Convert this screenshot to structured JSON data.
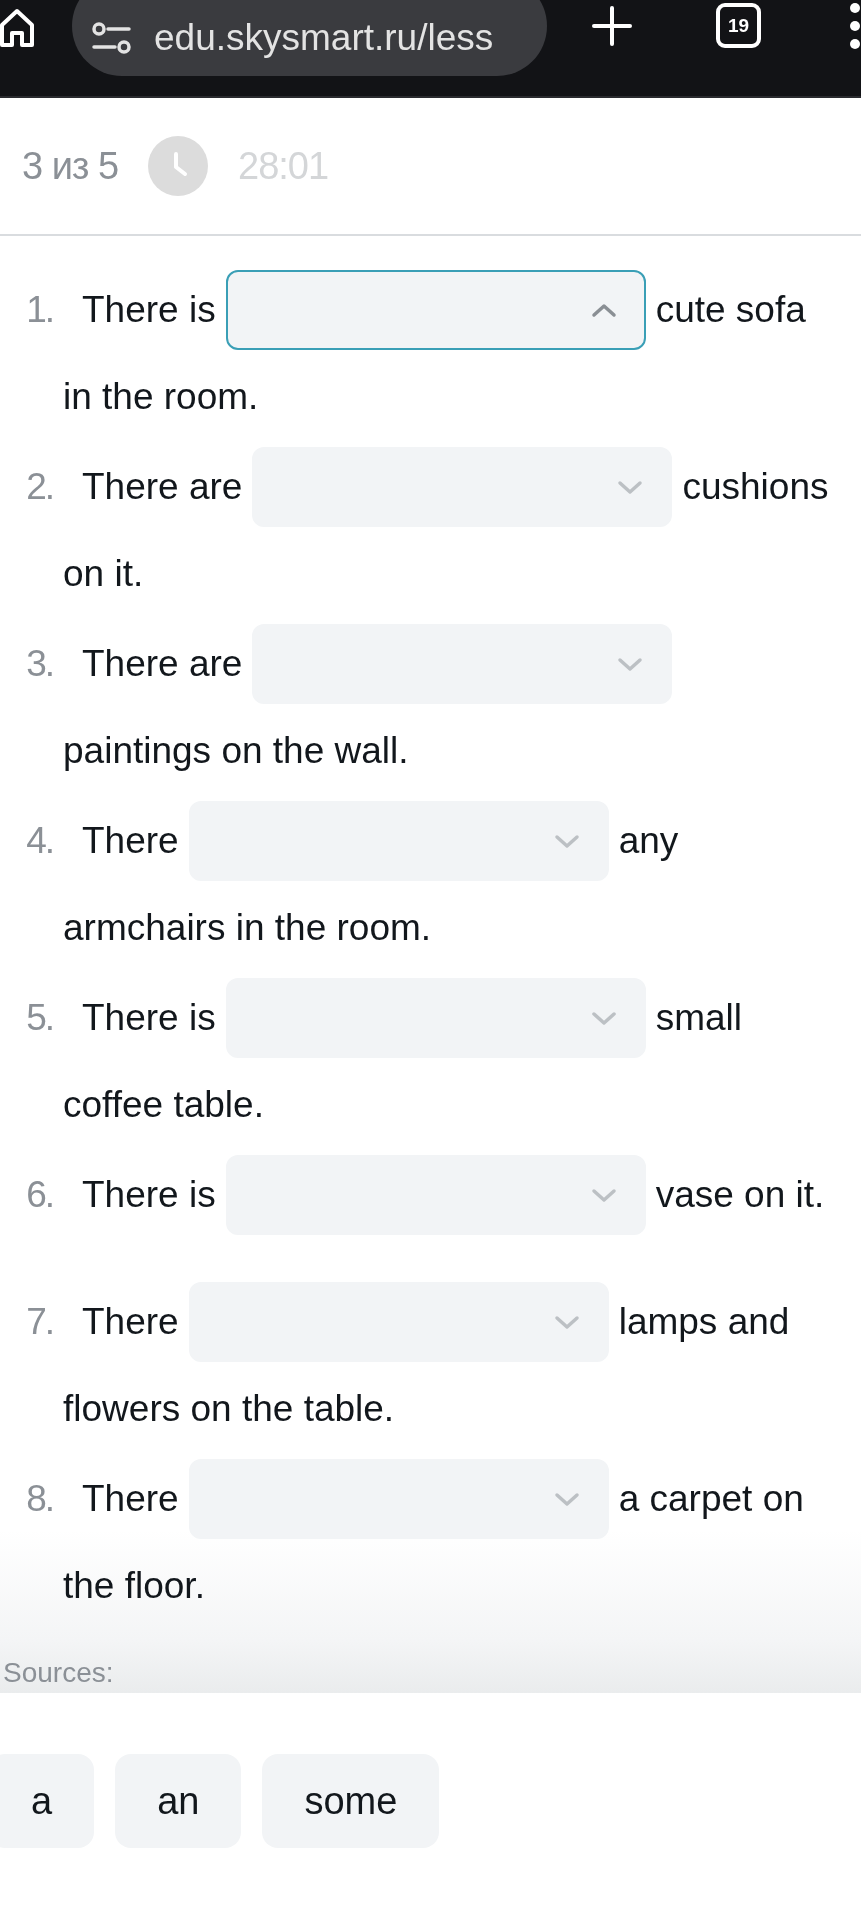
{
  "browser_toolbar": {
    "url": "edu.skysmart.ru/less",
    "tab_count": "19"
  },
  "header": {
    "progress": "3 из 5",
    "timer": "28:01"
  },
  "exercise": {
    "items": [
      {
        "number": "1.",
        "lead": "There is",
        "blank": {
          "expanded": true
        },
        "tail": "cute sofa",
        "next_line": "in the room."
      },
      {
        "number": "2.",
        "lead": "There are",
        "blank": {
          "expanded": false
        },
        "tail": "cushions",
        "next_line": "on it."
      },
      {
        "number": "3.",
        "lead": "There are",
        "blank": {
          "expanded": false
        },
        "next_line": "paintings on the wall."
      },
      {
        "number": "4.",
        "lead": "There",
        "blank": {
          "expanded": false
        },
        "tail": "any",
        "next_line": "armchairs in the room."
      },
      {
        "number": "5.",
        "lead": "There is",
        "blank": {
          "expanded": false
        },
        "tail": "small",
        "next_line": "coffee table."
      },
      {
        "number": "6.",
        "lead": "There is",
        "blank": {
          "expanded": false
        },
        "tail": "vase on it."
      },
      {
        "number": "7.",
        "lead": "There",
        "blank": {
          "expanded": false
        },
        "tail": "lamps and",
        "next_line": "flowers on the table."
      },
      {
        "number": "8.",
        "lead": "There",
        "blank": {
          "expanded": false
        },
        "tail": "a carpet on",
        "next_line": "the floor."
      }
    ]
  },
  "sources": {
    "label": "Sources:",
    "options": [
      "a",
      "an",
      "some"
    ]
  }
}
